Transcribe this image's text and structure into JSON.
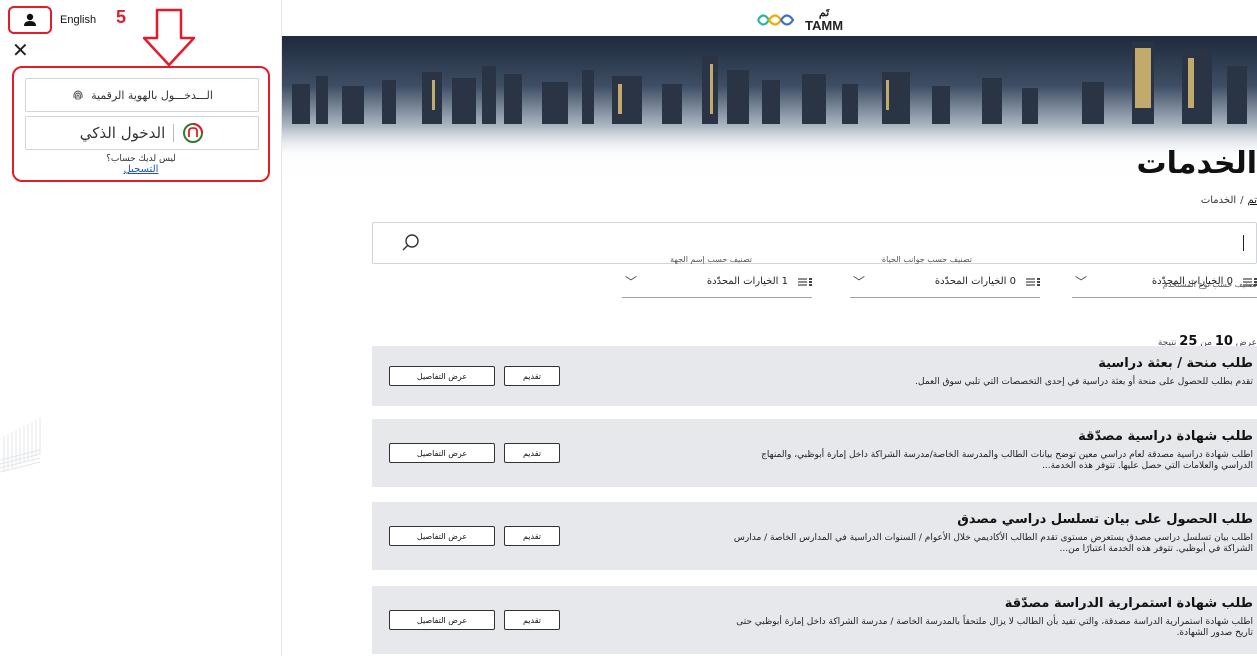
{
  "header": {
    "language_label": "English",
    "step_number": "5",
    "logo_text": "TAMM",
    "logo_arabic": "تَم"
  },
  "login": {
    "uae_pass_label": "الـــدخـــول بالهوية الرقمية",
    "smart_login_label": "الدخول الذكي",
    "no_account_text": "ليس لديك حساب؟",
    "register_link": "التسجيل"
  },
  "page": {
    "title": "الخدمات",
    "breadcrumb": {
      "home": "تم",
      "separator": "/",
      "current": "الخدمات"
    }
  },
  "search": {
    "placeholder": ""
  },
  "filters": [
    {
      "label": "تصنيف حسب نوع المستخدم",
      "value": "0 الخيارات المحدّدة"
    },
    {
      "label": "تصنيف حسب جوانب الحياة",
      "value": "0 الخيارات المحدّدة"
    },
    {
      "label": "تصنيف حسب إسم الجهة",
      "value": "1 الخيارات المحدّدة"
    }
  ],
  "results": {
    "prefix": "عرض",
    "shown": "10",
    "of": "من",
    "total": "25",
    "suffix": "نتيجة"
  },
  "services": [
    {
      "title": "طلب منحة / بعثة دراسية",
      "description": "تقدم بطلب للحصول على منحة أو بعثة دراسية في إحدى التخصصات التي تلبي سوق العمل.",
      "apply_label": "تقديم",
      "details_label": "عرض التفاصيل"
    },
    {
      "title": "طلب شهادة دراسية مصدّقة",
      "description": "اطلب شهادة دراسية مصدقة لعام دراسي معين توضح بيانات الطالب والمدرسة الخاصة/مدرسة الشراكة داخل إمارة أبوظبي، والمنهاج الدراسي والعلامات التي حصل عليها. تتوفر هذه الخدمة...",
      "apply_label": "تقديم",
      "details_label": "عرض التفاصيل"
    },
    {
      "title": "طلب الحصول على بيان تسلسل دراسي مصدق",
      "description": "اطلب بيان تسلسل دراسي مصدق يستعرض مستوى تقدم الطالب الأكاديمي خلال الأعوام / السنوات الدراسية في المدارس الخاصة / مدارس الشراكة في أبوظبي. تتوفر هذه الخدمة اعتبارًا من...",
      "apply_label": "تقديم",
      "details_label": "عرض التفاصيل"
    },
    {
      "title": "طلب شهادة استمرارية الدراسة مصدّقة",
      "description": "اطلب شهادة استمرارية الدراسة مصدقة، والتي تفيد بأن الطالب لا يزال ملتحقاً بالمدرسة الخاصة / مدرسة الشراكة داخل إمارة أبوظبي حتى تاريخ صدور الشهادة.",
      "apply_label": "تقديم",
      "details_label": "عرض التفاصيل"
    }
  ],
  "colors": {
    "highlight_red": "#e11d2a",
    "card_bg": "#e7e8ec",
    "link_blue": "#1d4ed8"
  },
  "icons": {
    "user": "user-icon",
    "close": "close-icon",
    "search": "search-icon",
    "fingerprint": "fingerprint-icon",
    "smart_login": "smart-login-icon",
    "chevron": "chevron-down-icon",
    "filter": "filter-list-icon"
  }
}
